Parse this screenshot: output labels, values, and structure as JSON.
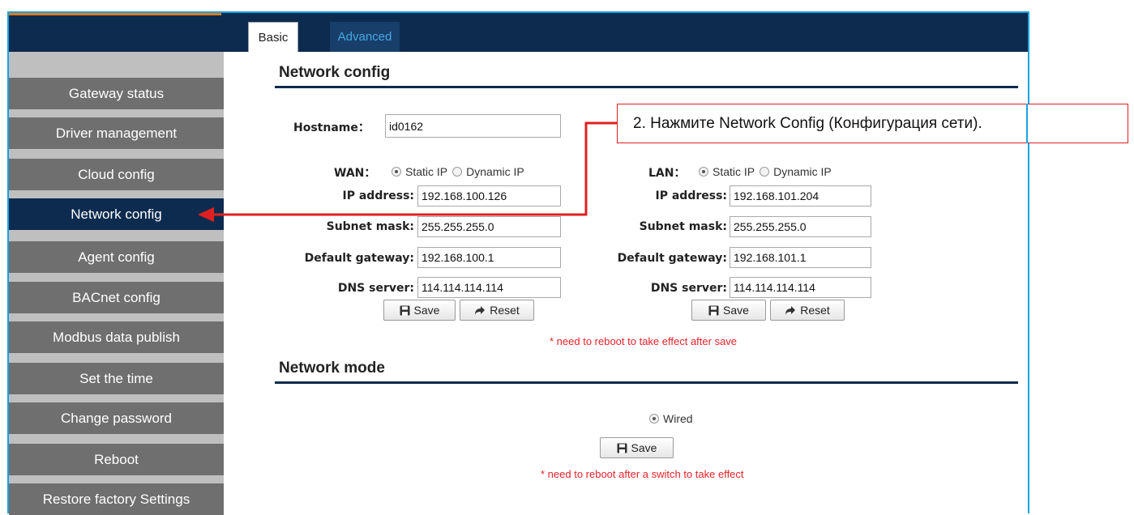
{
  "tabs": {
    "basic": "Basic",
    "advanced": "Advanced"
  },
  "sidebar": {
    "items": [
      {
        "label": "Gateway status"
      },
      {
        "label": "Driver management"
      },
      {
        "label": "Cloud config"
      },
      {
        "label": "Network config",
        "active": true
      },
      {
        "label": "Agent config"
      },
      {
        "label": "BACnet config"
      },
      {
        "label": "Modbus data publish"
      },
      {
        "label": "Set the time"
      },
      {
        "label": "Change password"
      },
      {
        "label": "Reboot"
      },
      {
        "label": "Restore factory Settings"
      }
    ]
  },
  "network_config": {
    "title": "Network config",
    "hostname_label": "Hostname：",
    "hostname_value": "id0162",
    "wan": {
      "label": "WAN：",
      "static_label": "Static IP",
      "dynamic_label": "Dynamic IP",
      "ip_label": "IP address:",
      "ip_value": "192.168.100.126",
      "mask_label": "Subnet mask:",
      "mask_value": "255.255.255.0",
      "gw_label": "Default gateway:",
      "gw_value": "192.168.100.1",
      "dns_label": "DNS server:",
      "dns_value": "114.114.114.114",
      "save": "Save",
      "reset": "Reset"
    },
    "lan": {
      "label": "LAN：",
      "static_label": "Static IP",
      "dynamic_label": "Dynamic IP",
      "ip_label": "IP address:",
      "ip_value": "192.168.101.204",
      "mask_label": "Subnet mask:",
      "mask_value": "255.255.255.0",
      "gw_label": "Default gateway:",
      "gw_value": "192.168.101.1",
      "dns_label": "DNS server:",
      "dns_value": "114.114.114.114",
      "save": "Save",
      "reset": "Reset"
    },
    "note": "* need to reboot to take effect after save"
  },
  "network_mode": {
    "title": "Network mode",
    "wired_label": "Wired",
    "save": "Save",
    "note": "* need to reboot after a switch to take effect"
  },
  "callout": {
    "text": "2. Нажмите Network Config (Конфигурация сети)."
  },
  "colors": {
    "nav_dark": "#0d2b4e",
    "frame_cyan": "#17a3e0",
    "annotation_red": "#e02020",
    "sidebar_gray": "#6f6f6f"
  }
}
